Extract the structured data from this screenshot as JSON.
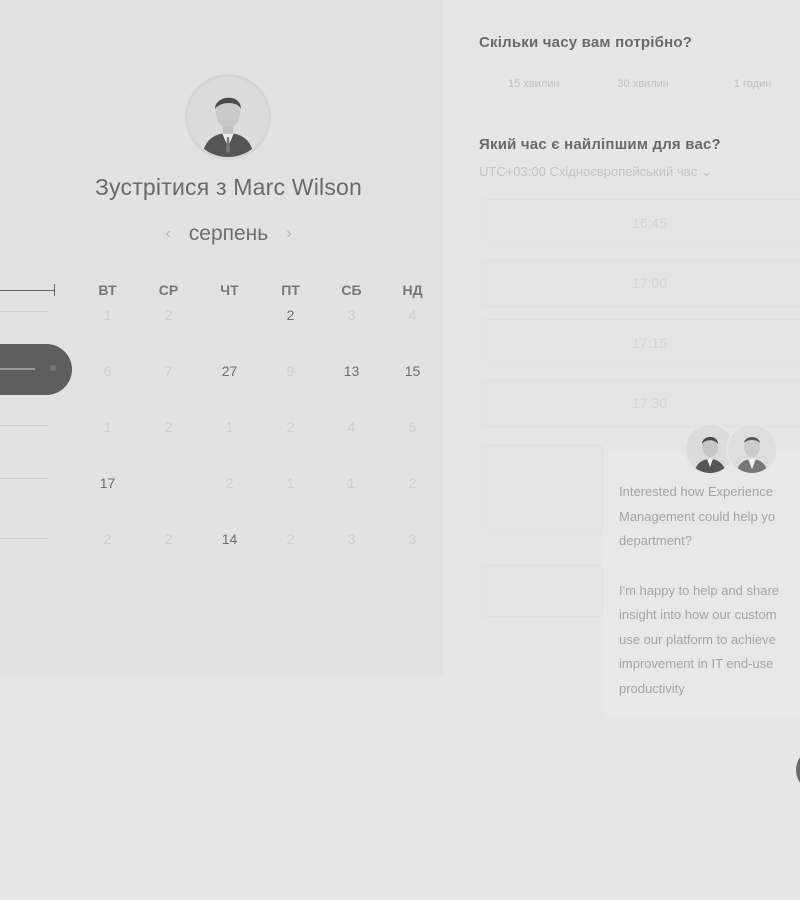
{
  "meeting": {
    "title": "Зустрітися з Marc Wilson",
    "month": "серпень",
    "prev_label": "‹",
    "next_label": "›"
  },
  "calendar": {
    "weekdays": [
      "ВТ",
      "СР",
      "ЧТ",
      "ПТ",
      "СБ",
      "НД"
    ],
    "rows": [
      [
        {
          "d": "1",
          "a": false
        },
        {
          "d": "2",
          "a": false
        },
        {
          "d": "",
          "a": false
        },
        {
          "d": "2",
          "a": true
        },
        {
          "d": "3",
          "a": false
        },
        {
          "d": "4",
          "a": false
        }
      ],
      [
        {
          "d": "6",
          "a": false
        },
        {
          "d": "7",
          "a": false
        },
        {
          "d": "27",
          "a": true
        },
        {
          "d": "9",
          "a": false
        },
        {
          "d": "13",
          "a": true
        },
        {
          "d": "15",
          "a": true
        }
      ],
      [
        {
          "d": "1",
          "a": false
        },
        {
          "d": "2",
          "a": false
        },
        {
          "d": "1",
          "a": false
        },
        {
          "d": "2",
          "a": false
        },
        {
          "d": "4",
          "a": false
        },
        {
          "d": "5",
          "a": false
        }
      ],
      [
        {
          "d": "17",
          "a": true
        },
        {
          "d": "",
          "a": false
        },
        {
          "d": "2",
          "a": false
        },
        {
          "d": "1",
          "a": false
        },
        {
          "d": "1",
          "a": false
        },
        {
          "d": "2",
          "a": false
        }
      ],
      [
        {
          "d": "2",
          "a": false
        },
        {
          "d": "2",
          "a": false
        },
        {
          "d": "14",
          "a": true
        },
        {
          "d": "2",
          "a": false
        },
        {
          "d": "3",
          "a": false
        },
        {
          "d": "3",
          "a": false
        }
      ]
    ]
  },
  "duration": {
    "question": "Скільки часу вам потрібно?",
    "options": [
      "15 хвилин",
      "30 хвилин",
      "1 годин"
    ]
  },
  "time": {
    "question": "Який час є найліпшим для вас?",
    "timezone": "UTC+03:00 Східноєвропейський час ⌄",
    "slots": [
      "16:45",
      "17:00",
      "17:15",
      "17:30"
    ]
  },
  "chat": {
    "paragraph1": [
      "Interested how Experience",
      "Management could help yo",
      "department?"
    ],
    "paragraph2": [
      "I'm happy to help and share",
      "insight into how our custom",
      "use our platform to achieve",
      "improvement in IT end-use",
      "productivity"
    ]
  }
}
